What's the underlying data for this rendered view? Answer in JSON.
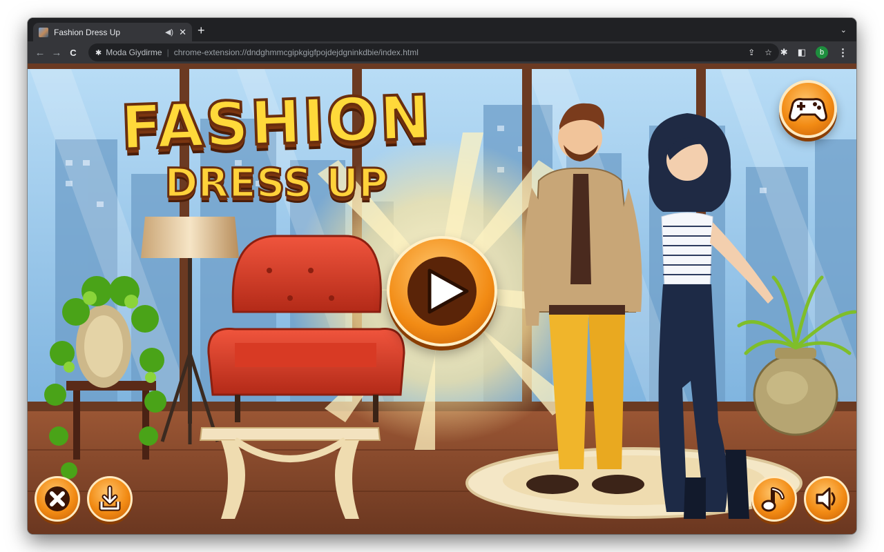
{
  "browser": {
    "tab_title": "Fashion Dress Up",
    "tab_audio_icon": "speaker-icon",
    "tab_close": "✕",
    "new_tab": "+",
    "tab_menu": "⌄",
    "back": "←",
    "forward": "→",
    "reload": "C",
    "site_name": "Moda Giydirme",
    "url": "chrome-extension://dndghmmcgipkgigfpojdejdgninkdbie/index.html",
    "share": "⇪",
    "star": "☆",
    "extensions": "✱",
    "sidepanel": "◧",
    "profile_initial": "b",
    "menu": "⋮"
  },
  "game": {
    "title_line1": "FASHION",
    "title_line2": "DRESS UP",
    "colors": {
      "sky": "#8fc3e8",
      "floor": "#8a4a2c",
      "orange": "#f08a14",
      "title_yellow": "#ffd93a",
      "title_outline": "#6a2e0e"
    },
    "buttons": {
      "play": "play-icon",
      "more_games": "gamepad-icon",
      "close": "close-icon",
      "download": "download-icon",
      "music": "music-note-icon",
      "sound": "speaker-icon"
    }
  }
}
